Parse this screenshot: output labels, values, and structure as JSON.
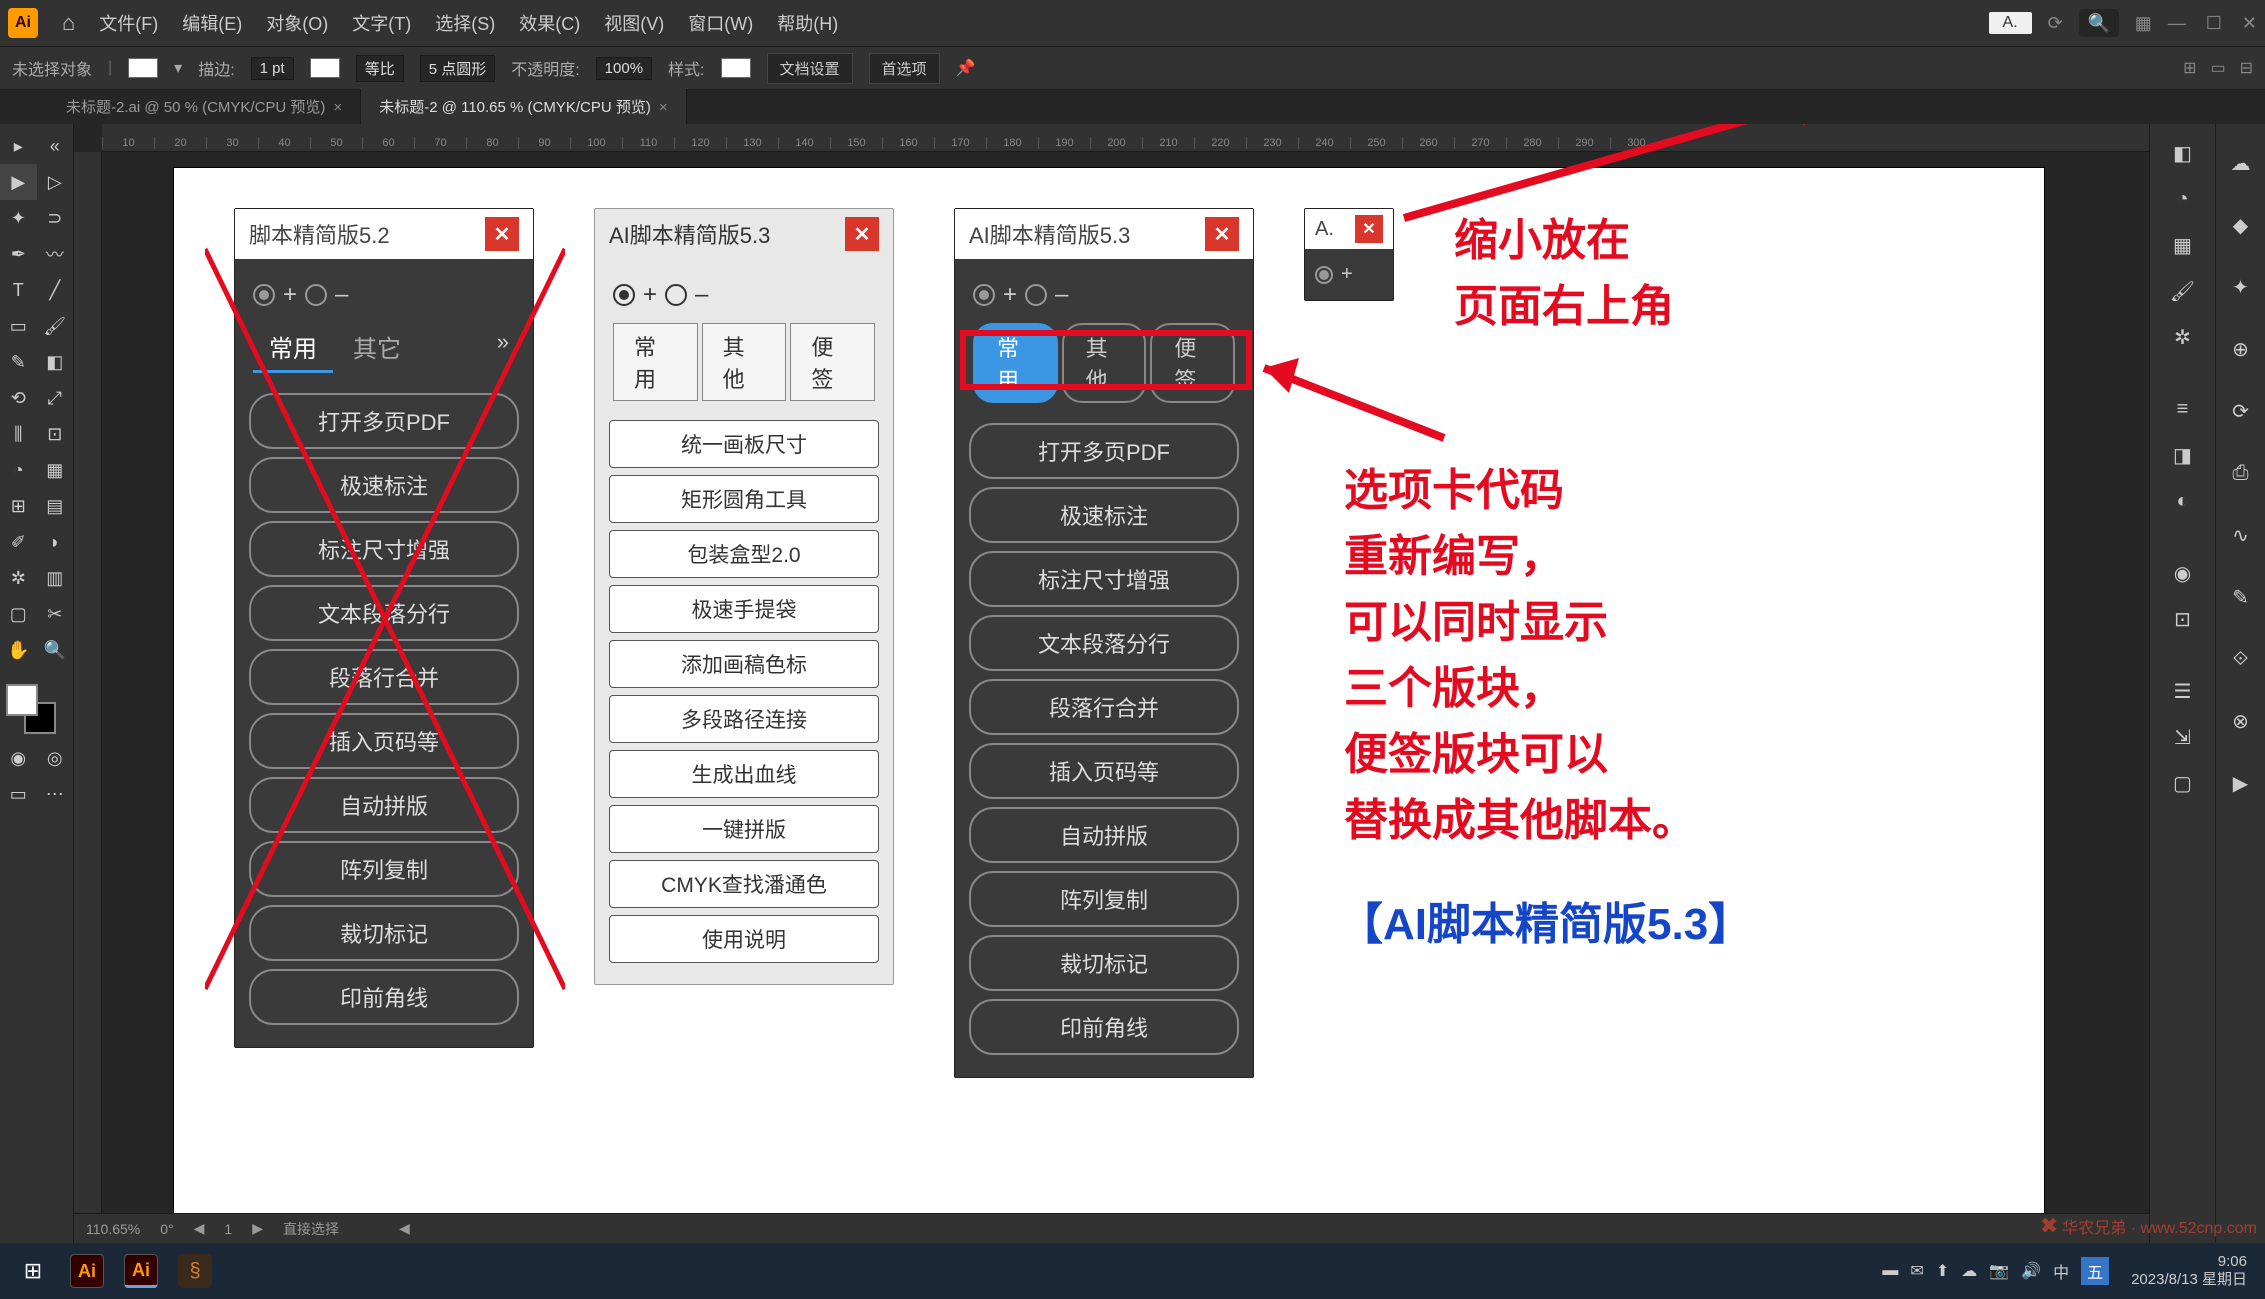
{
  "menubar": {
    "items": [
      "文件(F)",
      "编辑(E)",
      "对象(O)",
      "文字(T)",
      "选择(S)",
      "效果(C)",
      "视图(V)",
      "窗口(W)",
      "帮助(H)"
    ],
    "mini_panel_placeholder": "A."
  },
  "optbar": {
    "no_selection": "未选择对象",
    "stroke_label": "描边:",
    "stroke_value": "1 pt",
    "uniform": "等比",
    "point_round": "5 点圆形",
    "opacity_label": "不透明度:",
    "opacity_value": "100%",
    "style_label": "样式:",
    "doc_setup": "文档设置",
    "prefs": "首选项"
  },
  "tabs": [
    {
      "label": "未标题-2.ai @ 50 % (CMYK/CPU 预览)",
      "active": false
    },
    {
      "label": "未标题-2 @ 110.65 % (CMYK/CPU 预览)",
      "active": true
    }
  ],
  "ruler_marks": [
    "10",
    "20",
    "30",
    "40",
    "50",
    "60",
    "70",
    "80",
    "90",
    "100",
    "110",
    "120",
    "130",
    "140",
    "150",
    "160",
    "170",
    "180",
    "190",
    "200",
    "210",
    "220",
    "230",
    "240",
    "250",
    "260",
    "270",
    "280",
    "290",
    "300"
  ],
  "panel1": {
    "title": "脚本精简版5.2",
    "tabs": [
      "常用",
      "其它"
    ],
    "buttons": [
      "打开多页PDF",
      "极速标注",
      "标注尺寸增强",
      "文本段落分行",
      "段落行合并",
      "插入页码等",
      "自动拼版",
      "阵列复制",
      "裁切标记",
      "印前角线"
    ]
  },
  "panel2": {
    "title": "AI脚本精简版5.3",
    "tabs": [
      "常用",
      "其他",
      "便签"
    ],
    "buttons": [
      "统一画板尺寸",
      "矩形圆角工具",
      "包装盒型2.0",
      "极速手提袋",
      "添加画稿色标",
      "多段路径连接",
      "生成出血线",
      "一键拼版",
      "CMYK查找潘通色",
      "使用说明"
    ]
  },
  "panel3": {
    "title": "AI脚本精简版5.3",
    "tabs": [
      "常用",
      "其他",
      "便签"
    ],
    "buttons": [
      "打开多页PDF",
      "极速标注",
      "标注尺寸增强",
      "文本段落分行",
      "段落行合并",
      "插入页码等",
      "自动拼版",
      "阵列复制",
      "裁切标记",
      "印前角线"
    ]
  },
  "panel4": {
    "title": "A."
  },
  "annotations": {
    "top": "缩小放在\n页面右上角",
    "mid": "选项卡代码\n重新编写，\n可以同时显示\n三个版块，\n便签版块可以\n替换成其他脚本。",
    "bottom": "【AI脚本精简版5.3】"
  },
  "statusbar": {
    "zoom": "110.65%",
    "rotate": "0°",
    "artboard_nav": "1",
    "tool": "直接选择"
  },
  "taskbar": {
    "time": "9:06",
    "date": "2023/8/13 星期日"
  },
  "watermark": "华农兄弟 · www.52cnp.com"
}
